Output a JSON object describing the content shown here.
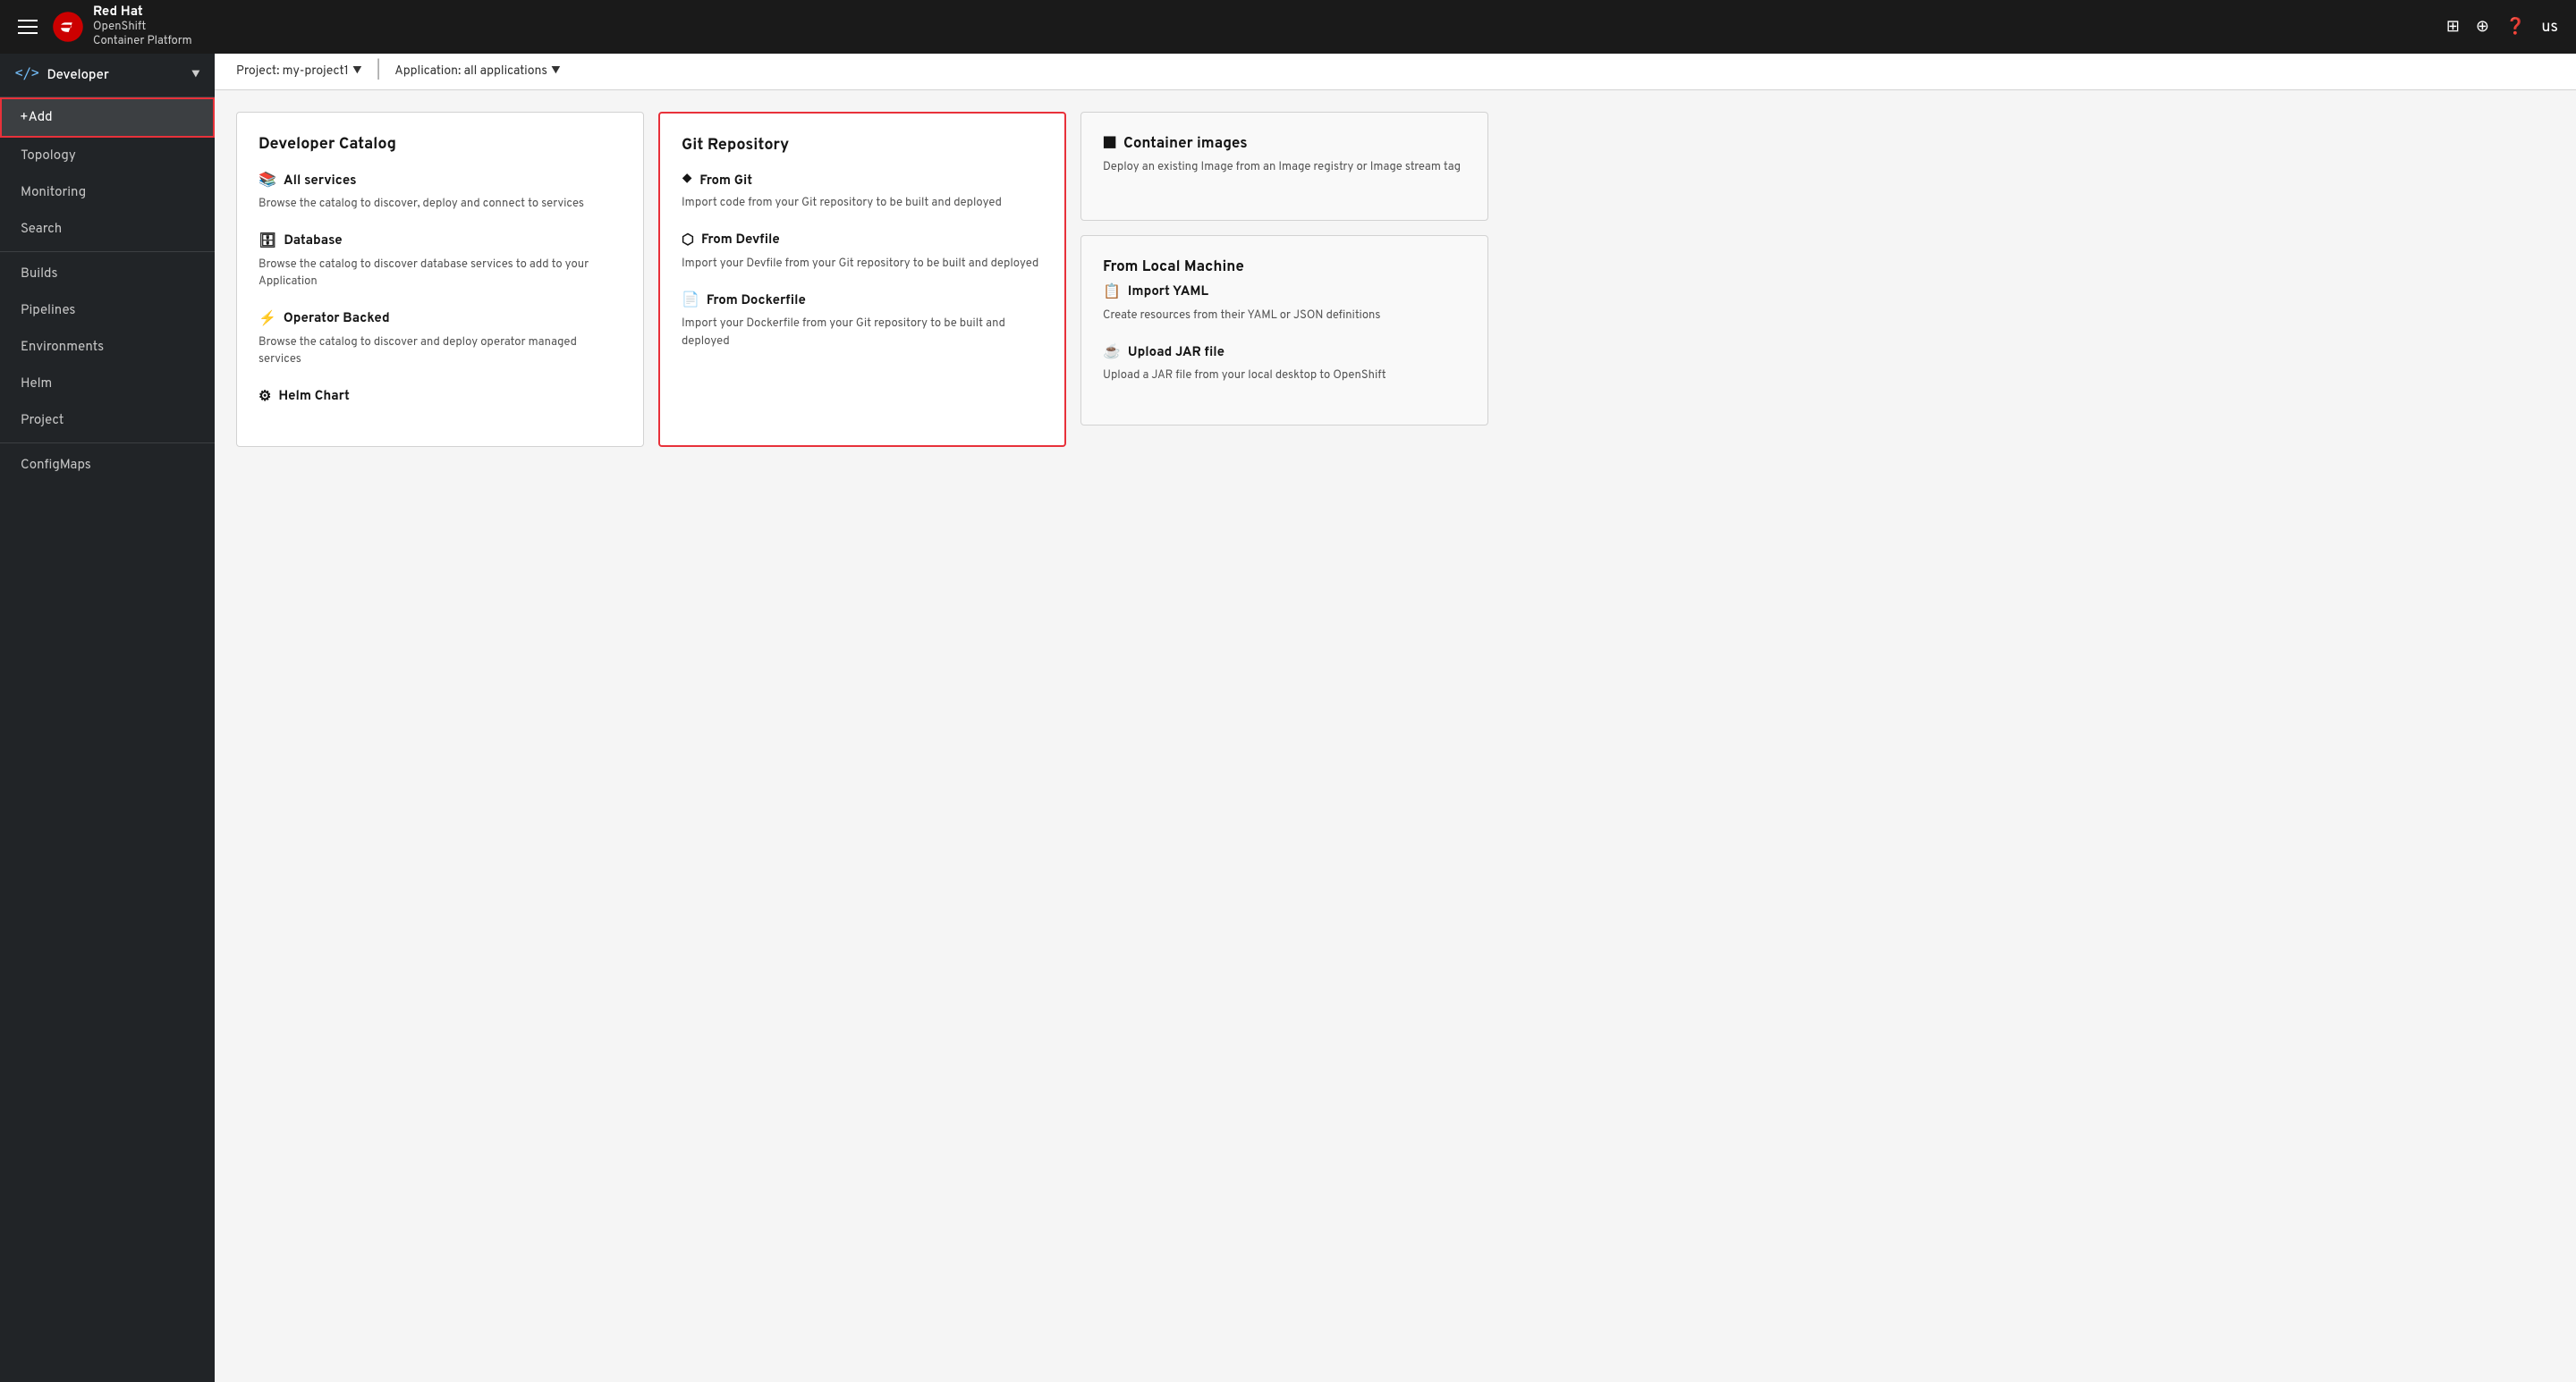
{
  "topbar": {
    "brand_name": "Red Hat",
    "brand_line1": "OpenShift",
    "brand_line2": "Container Platform"
  },
  "sidebar": {
    "perspective": "Developer",
    "items": [
      {
        "id": "add",
        "label": "+Add",
        "active": true
      },
      {
        "id": "topology",
        "label": "Topology",
        "active": false
      },
      {
        "id": "monitoring",
        "label": "Monitoring",
        "active": false
      },
      {
        "id": "search",
        "label": "Search",
        "active": false
      },
      {
        "id": "builds",
        "label": "Builds",
        "active": false
      },
      {
        "id": "pipelines",
        "label": "Pipelines",
        "active": false
      },
      {
        "id": "environments",
        "label": "Environments",
        "active": false
      },
      {
        "id": "helm",
        "label": "Helm",
        "active": false
      },
      {
        "id": "project",
        "label": "Project",
        "active": false
      },
      {
        "id": "configmaps",
        "label": "ConfigMaps",
        "active": false
      }
    ]
  },
  "subheader": {
    "project_label": "Project: my-project1",
    "application_label": "Application: all applications"
  },
  "developer_catalog": {
    "title": "Developer Catalog",
    "sections": [
      {
        "id": "all-services",
        "icon": "📚",
        "title": "All services",
        "desc": "Browse the catalog to discover, deploy and connect to services"
      },
      {
        "id": "database",
        "icon": "🗄",
        "title": "Database",
        "desc": "Browse the catalog to discover database services to add to your Application"
      },
      {
        "id": "operator-backed",
        "icon": "⚡",
        "title": "Operator Backed",
        "desc": "Browse the catalog to discover and deploy operator managed services"
      },
      {
        "id": "helm-chart",
        "icon": "⚙",
        "title": "Helm Chart",
        "desc": ""
      }
    ]
  },
  "git_repository": {
    "title": "Git Repository",
    "sections": [
      {
        "id": "from-git",
        "icon": "◆",
        "title": "From Git",
        "desc": "Import code from your Git repository to be built and deployed"
      },
      {
        "id": "from-devfile",
        "icon": "⬡",
        "title": "From Devfile",
        "desc": "Import your Devfile from your Git repository to be built and deployed"
      },
      {
        "id": "from-dockerfile",
        "icon": "📄",
        "title": "From Dockerfile",
        "desc": "Import your Dockerfile from your Git repository to be built and deployed"
      }
    ]
  },
  "container_images": {
    "title": "Container images",
    "desc": "Deploy an existing Image from an Image registry or Image stream tag"
  },
  "from_local_machine": {
    "title": "From Local Machine",
    "sections": [
      {
        "id": "import-yaml",
        "icon": "📋",
        "title": "Import YAML",
        "desc": "Create resources from their YAML or JSON definitions"
      },
      {
        "id": "upload-jar",
        "icon": "☕",
        "title": "Upload JAR file",
        "desc": "Upload a JAR file from your local desktop to OpenShift"
      }
    ]
  }
}
